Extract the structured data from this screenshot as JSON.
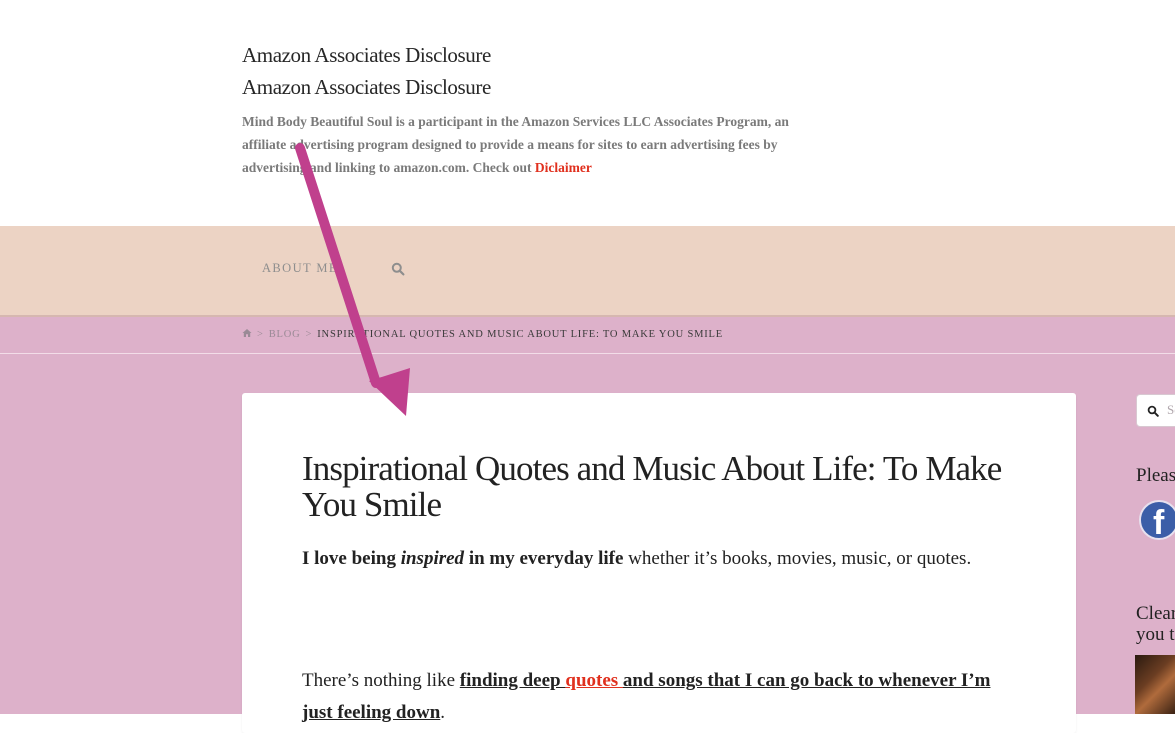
{
  "header": {
    "title_1": "Amazon Associates Disclosure",
    "title_2": "Amazon Associates Disclosure",
    "disclosure_text": "Mind Body Beautiful Soul is a participant in the Amazon Services LLC Associates Program, an affiliate advertising program designed to provide a means for sites to earn advertising fees by advertising and linking to amazon.com. Check out ",
    "disclaimer_link": "Diclaimer"
  },
  "nav": {
    "about_label": "ABOUT ME",
    "search_icon": "search-icon"
  },
  "breadcrumb": {
    "home_icon": "home-icon",
    "separator": ">",
    "blog": "BLOG",
    "current": "INSPIRATIONAL QUOTES AND MUSIC ABOUT LIFE: TO MAKE YOU SMILE"
  },
  "post": {
    "title": "Inspirational Quotes and Music About Life: To Make You Smile",
    "p1_bold_1": "I love being ",
    "p1_italic": "inspired",
    "p1_bold_2": " in my everyday life",
    "p1_rest": " whether it’s books, movies, music, or quotes.",
    "p2_start": "There’s nothing like ",
    "p2_ul_1": "finding deep ",
    "p2_link": "quotes ",
    "p2_ul_2": "and songs that I can go back to whenever I’m just feeling down",
    "p2_end": "."
  },
  "sidebar": {
    "search_placeholder": "Se",
    "please_text": "Pleas",
    "facebook_icon": "facebook-icon",
    "clear_text_1": "Clear",
    "clear_text_2": "you t"
  },
  "colors": {
    "navbar_bg": "#ecd3c4",
    "page_bg": "#ddb1ca",
    "link_red": "#e0301e",
    "arrow_magenta": "#c0408d"
  }
}
